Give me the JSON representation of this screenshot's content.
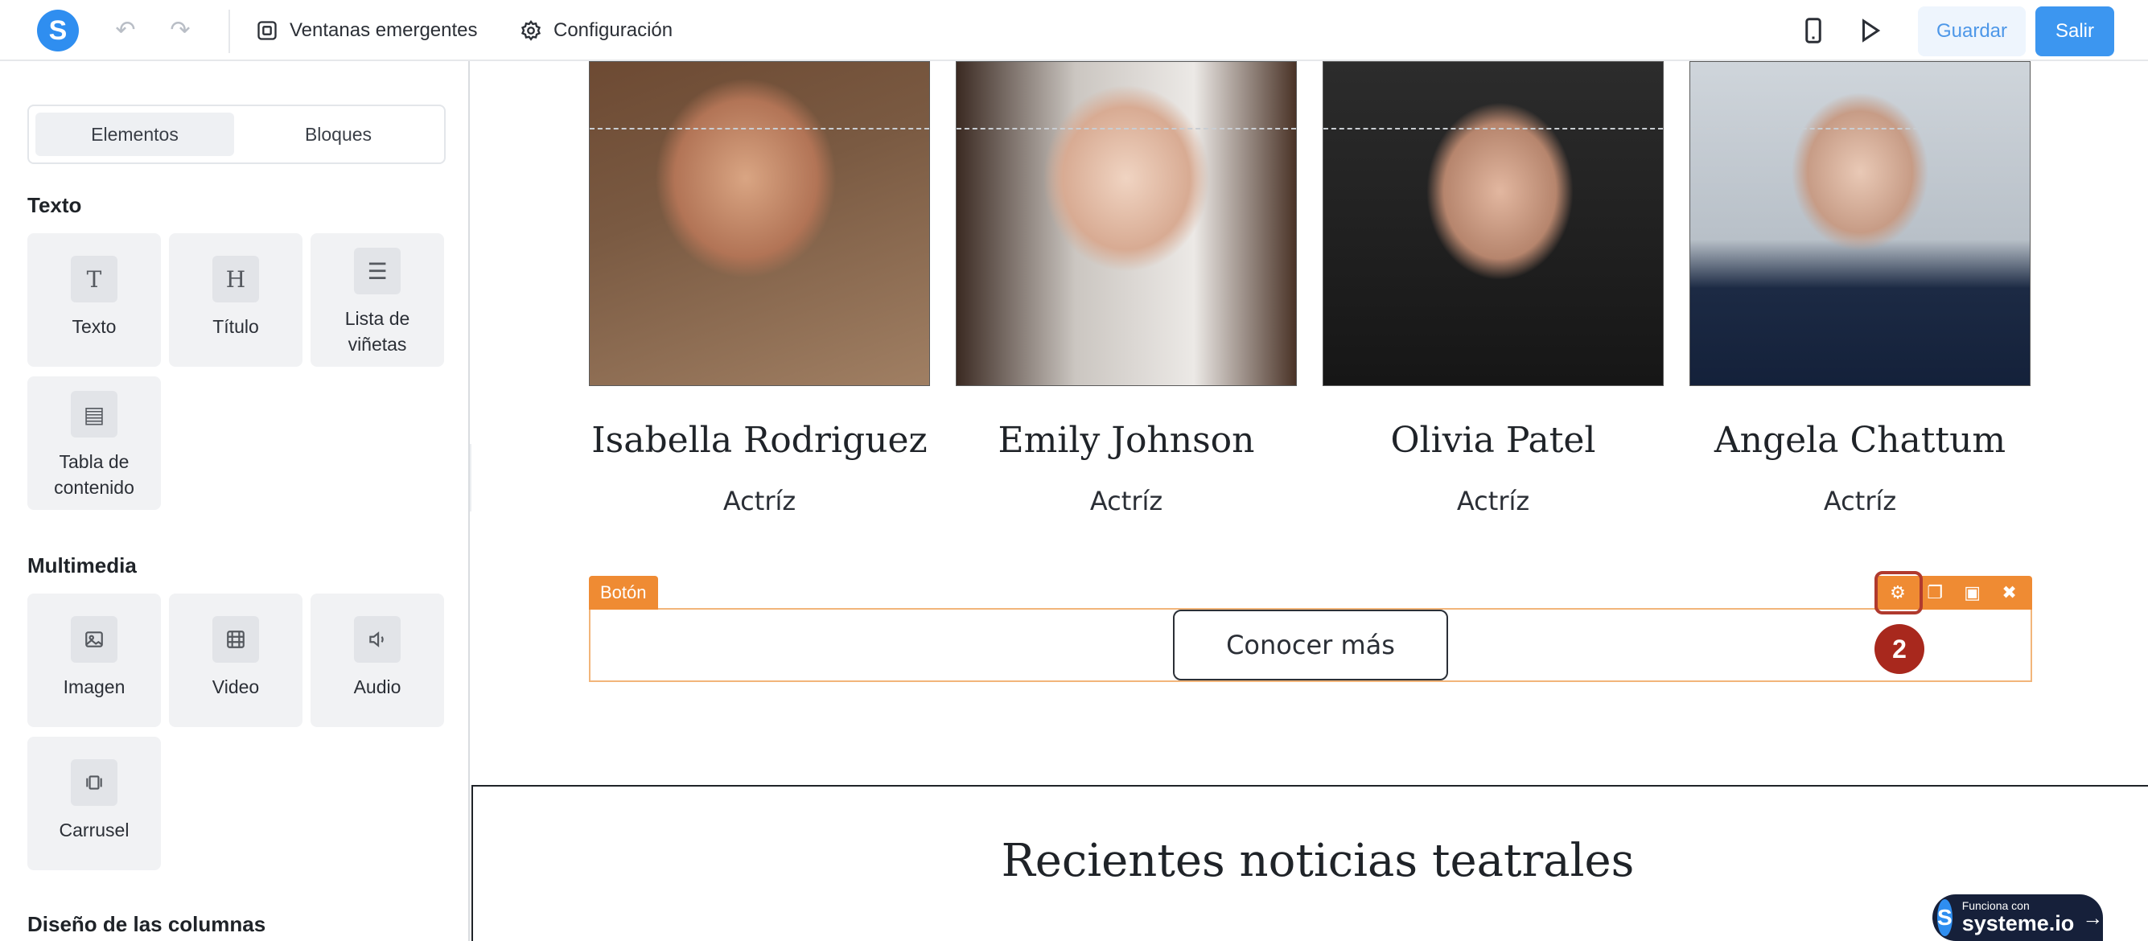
{
  "topbar": {
    "logo_letter": "S",
    "popups_label": "Ventanas emergentes",
    "settings_label": "Configuración",
    "save_label": "Guardar",
    "exit_label": "Salir"
  },
  "sidebar": {
    "tabs": [
      "Elementos",
      "Bloques"
    ],
    "sections": [
      {
        "title": "Texto",
        "items": [
          "Texto",
          "Título",
          "Lista de viñetas",
          "Tabla de contenido"
        ]
      },
      {
        "title": "Multimedia",
        "items": [
          "Imagen",
          "Video",
          "Audio",
          "Carrusel"
        ]
      },
      {
        "title": "Diseño de las columnas"
      }
    ]
  },
  "team": [
    {
      "name": "Isabella Rodriguez",
      "role": "Actríz"
    },
    {
      "name": "Emily Johnson",
      "role": "Actríz"
    },
    {
      "name": "Olivia Patel",
      "role": "Actríz"
    },
    {
      "name": "Angela Chattum",
      "role": "Actríz"
    }
  ],
  "button_element": {
    "tag": "Botón",
    "label": "Conocer más",
    "step_marker": "2"
  },
  "news": {
    "title": "Recientes noticias teatrales"
  },
  "badge": {
    "small": "Funciona con",
    "brand": "systeme.io",
    "letter": "S"
  },
  "colors": {
    "accent": "#3c96f0",
    "selection": "#ef8b33",
    "marker": "#a8281d"
  }
}
